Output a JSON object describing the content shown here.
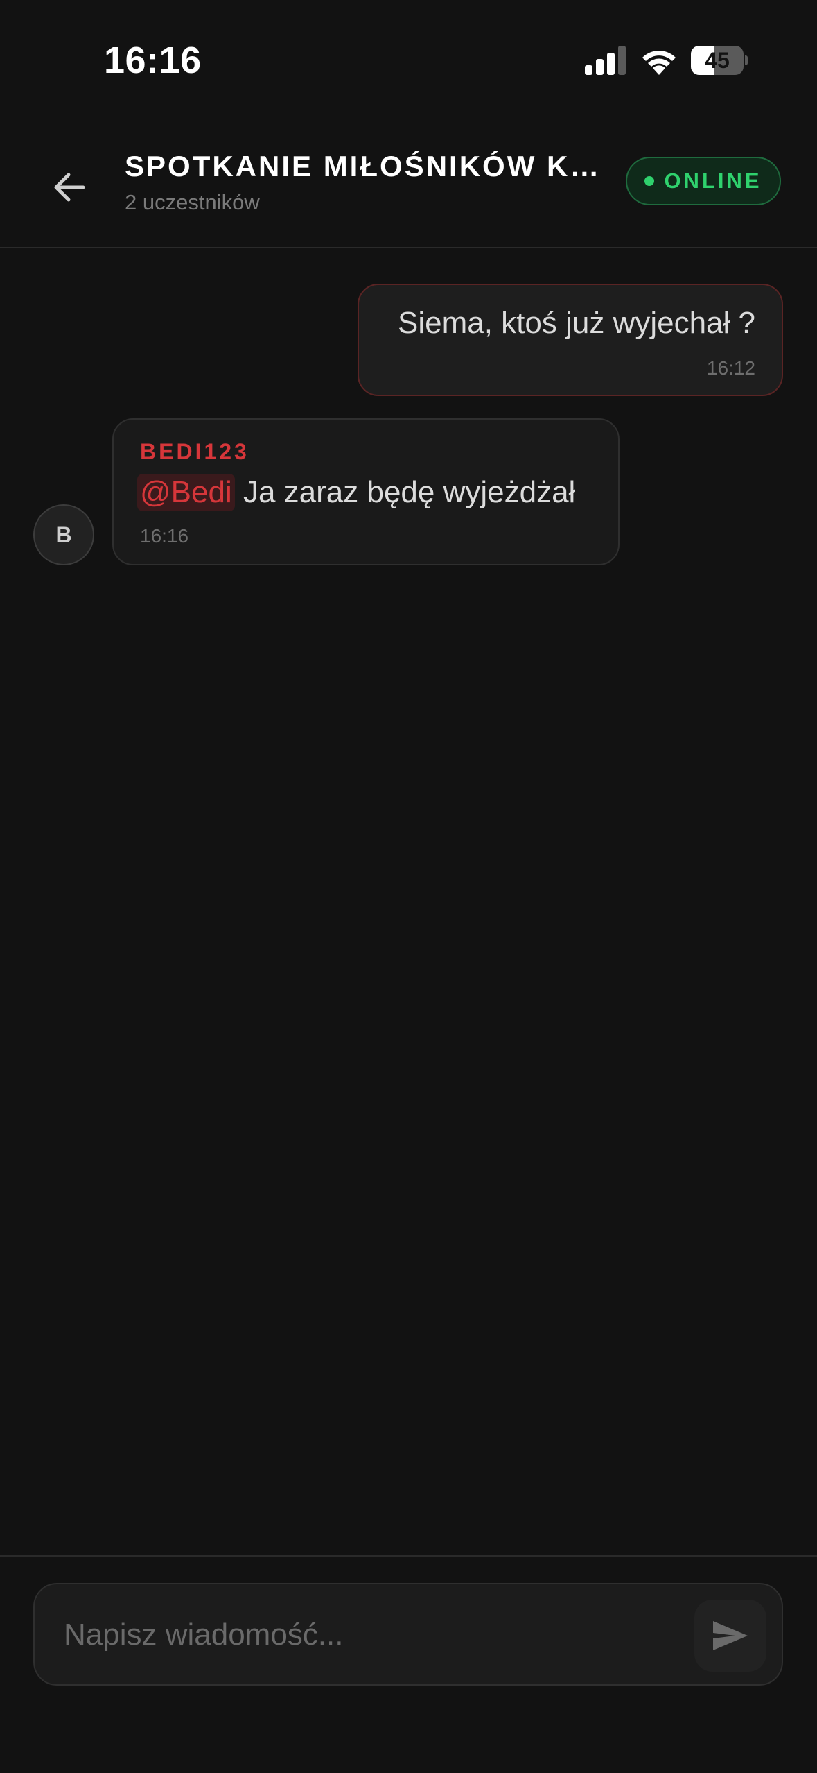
{
  "status_bar": {
    "time": "16:16",
    "battery_level": "45",
    "battery_fraction": 0.45,
    "signal_icon": "cellular-signal-icon",
    "wifi_icon": "wifi-icon"
  },
  "header": {
    "back_icon": "arrow-left-icon",
    "title": "SPOTKANIE MIŁOŚNIKÓW KLASYK...",
    "subtitle": "2 uczestników",
    "status_label": "ONLINE"
  },
  "messages": [
    {
      "direction": "outgoing",
      "text": "Siema, ktoś już wyjechał ?",
      "time": "16:12"
    },
    {
      "direction": "incoming",
      "sender": "BEDI123",
      "avatar_letter": "B",
      "mention": "@Bedi",
      "text": "Ja zaraz będę wyjeżdżał",
      "time": "16:16"
    }
  ],
  "composer": {
    "placeholder": "Napisz wiadomość...",
    "value": "",
    "send_icon": "send-icon"
  },
  "colors": {
    "background": "#121212",
    "accent_red": "#d6363a",
    "online_green": "#2fd16d"
  }
}
